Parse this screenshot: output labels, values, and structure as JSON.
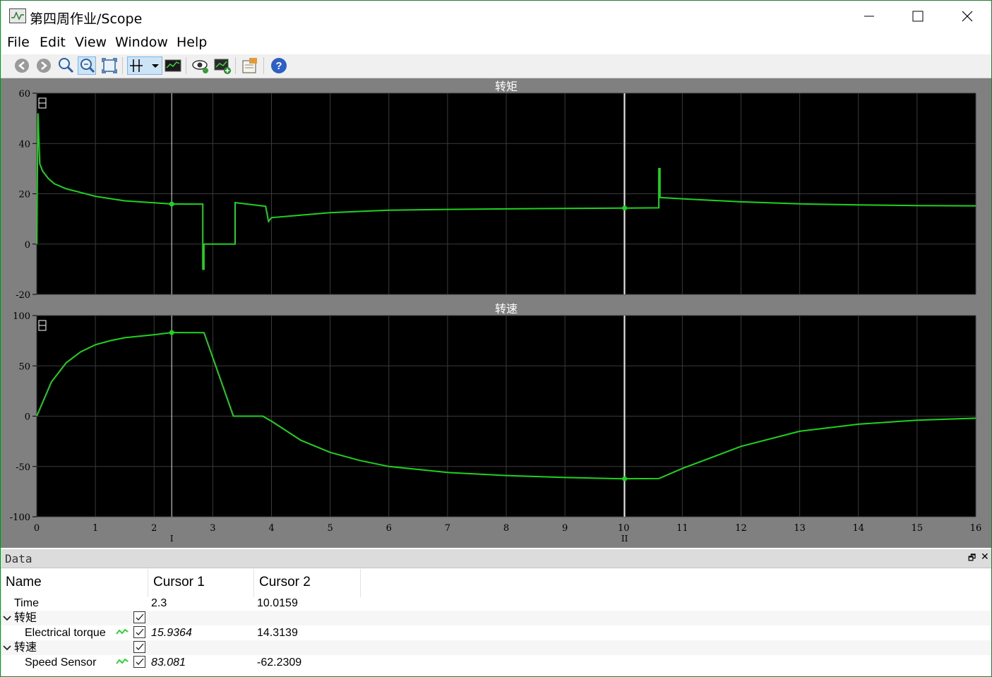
{
  "window": {
    "title": "第四周作业/Scope"
  },
  "menu": [
    "File",
    "Edit",
    "View",
    "Window",
    "Help"
  ],
  "toolbar": [
    "back-icon",
    "forward-icon",
    "zoom-icon",
    "zoom-xy-icon",
    "fit-icon",
    "cursor-measure-icon",
    "dropdown-icon",
    "plot-display-icon",
    "visibility-icon",
    "add-plot-icon",
    "properties-icon",
    "help-icon"
  ],
  "colors": {
    "trace": "#1fd21f",
    "plot_bg": "#000000",
    "frame": "#808080",
    "grid": "#3a3a3a",
    "cursor": "#e6e6e6"
  },
  "chart_data": [
    {
      "type": "line",
      "title": "转矩",
      "xlim": [
        0,
        16
      ],
      "ylim": [
        -20,
        60
      ],
      "x_ticks": [
        0,
        1,
        2,
        3,
        4,
        5,
        6,
        7,
        8,
        9,
        10,
        11,
        12,
        13,
        14,
        15,
        16
      ],
      "y_ticks": [
        60,
        40,
        20,
        0,
        -20
      ],
      "series": [
        {
          "name": "Electrical torque",
          "x": [
            0,
            0.02,
            0.05,
            0.1,
            0.2,
            0.3,
            0.5,
            0.75,
            1,
            1.5,
            2,
            2.3,
            2.83,
            2.83,
            2.85,
            2.85,
            3.35,
            3.38,
            3.38,
            3.9,
            3.9,
            3.95,
            4,
            4.5,
            5,
            6,
            7,
            8,
            9,
            10,
            10.6,
            10.6,
            10.62,
            10.62,
            11,
            12,
            13,
            14,
            15,
            16
          ],
          "y": [
            0,
            52,
            32,
            29,
            26,
            24,
            22,
            20.5,
            19,
            17.2,
            16.4,
            15.9364,
            15.9,
            -10,
            -10,
            0,
            0,
            0,
            16.5,
            15,
            15,
            9,
            10.5,
            11.5,
            12.5,
            13.5,
            13.8,
            14,
            14.2,
            14.3139,
            14.4,
            30,
            30,
            18.5,
            18,
            16.8,
            16,
            15.6,
            15.3,
            15.2
          ]
        }
      ],
      "cursors": [
        2.3,
        10.0159
      ]
    },
    {
      "type": "line",
      "title": "转速",
      "xlim": [
        0,
        16
      ],
      "ylim": [
        -100,
        100
      ],
      "x_ticks": [
        0,
        1,
        2,
        3,
        4,
        5,
        6,
        7,
        8,
        9,
        10,
        11,
        12,
        13,
        14,
        15,
        16
      ],
      "y_ticks": [
        100,
        50,
        0,
        -50,
        -100
      ],
      "series": [
        {
          "name": "Speed Sensor",
          "x": [
            0,
            0.25,
            0.5,
            0.75,
            1,
            1.25,
            1.5,
            2,
            2.3,
            2.85,
            3.35,
            3.85,
            4,
            4.5,
            5,
            5.5,
            6,
            7,
            8,
            9,
            10,
            10.6,
            11,
            12,
            13,
            14,
            15,
            16
          ],
          "y": [
            0,
            34,
            53,
            64,
            71,
            75,
            78,
            81,
            83.081,
            83,
            0,
            0,
            -5,
            -24,
            -36,
            -44,
            -50,
            -56,
            -59,
            -61,
            -62.2309,
            -62,
            -52,
            -30,
            -15,
            -8,
            -4,
            -2
          ]
        }
      ],
      "cursors": [
        2.3,
        10.0159
      ]
    }
  ],
  "cursor_labels": [
    "I",
    "II"
  ],
  "data_panel": {
    "title": "Data",
    "columns": [
      "Name",
      "Cursor 1",
      "Cursor 2"
    ],
    "rows": [
      {
        "name": "Time",
        "c1": "2.3",
        "c2": "10.0159"
      },
      {
        "group": "转矩"
      },
      {
        "name": "Electrical torque",
        "c1": "15.9364",
        "c2": "14.3139"
      },
      {
        "group": "转速"
      },
      {
        "name": "Speed Sensor",
        "c1": "83.081",
        "c2": "-62.2309"
      }
    ]
  }
}
